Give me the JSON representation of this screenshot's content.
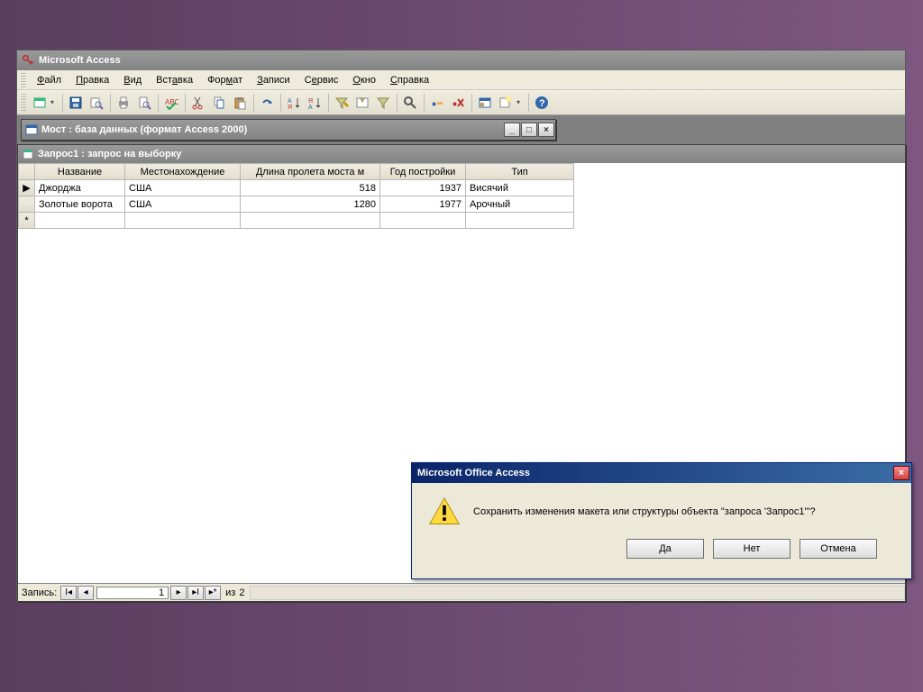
{
  "app": {
    "title": "Microsoft Access"
  },
  "menubar": {
    "items": [
      "Файл",
      "Правка",
      "Вид",
      "Вставка",
      "Формат",
      "Записи",
      "Сервис",
      "Окно",
      "Справка"
    ]
  },
  "db_window": {
    "title": "Мост : база данных (формат Access 2000)"
  },
  "query_window": {
    "title": "Запрос1 : запрос на выборку"
  },
  "datasheet": {
    "columns": [
      "Название",
      "Местонахождение",
      "Длина пролета моста м",
      "Год постройки",
      "Тип"
    ],
    "rows": [
      {
        "name": "Джорджа",
        "location": "США",
        "span": "518",
        "year": "1937",
        "type": "Висячий"
      },
      {
        "name": "Золотые ворота",
        "location": "США",
        "span": "1280",
        "year": "1977",
        "type": "Арочный"
      }
    ]
  },
  "record_nav": {
    "label": "Запись:",
    "current": "1",
    "of_label": "из",
    "total": "2"
  },
  "dialog": {
    "title": "Microsoft Office Access",
    "message": "Сохранить изменения макета или структуры объекта \"запроса 'Запрос1'\"?",
    "yes": "Да",
    "no": "Нет",
    "cancel": "Отмена"
  }
}
